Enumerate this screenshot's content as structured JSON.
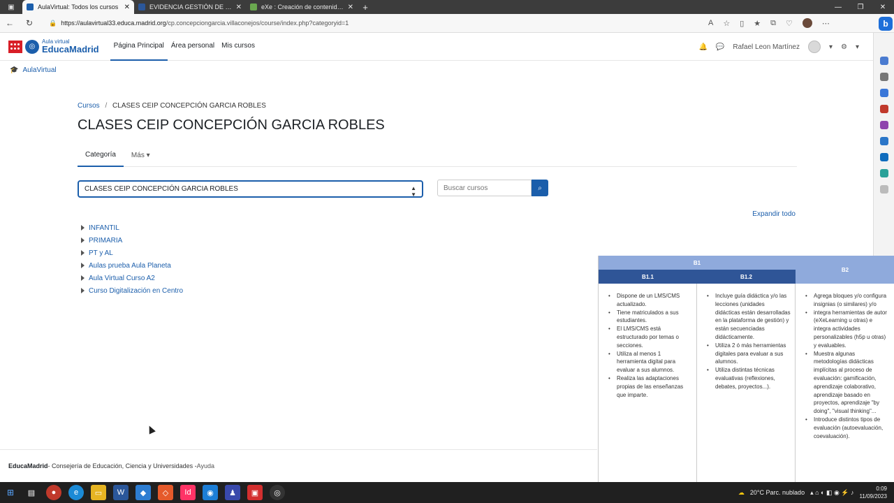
{
  "browser": {
    "tabs": [
      {
        "label": "AulaVirtual: Todos los cursos",
        "color": "#1b5eab",
        "active": true
      },
      {
        "label": "EVIDENCIA GESTIÓN DE PLATAF",
        "color": "#2b579a",
        "active": false
      },
      {
        "label": "eXe : Creación de contenidos di",
        "color": "#6aa84f",
        "active": false
      }
    ],
    "new_tab": "+",
    "url_host": "https://aulavirtual33.educa.madrid.org",
    "url_path": "/cp.concepciongarcia.villaconejos/course/index.php?categoryid=1"
  },
  "navbar": {
    "logo_small": "Aula virtual",
    "logo_big": "EducaMadrid",
    "items": [
      "Página Principal",
      "Área personal",
      "Mis cursos"
    ],
    "user_name": "Rafael Leon Martínez"
  },
  "home_link": "AulaVirtual",
  "breadcrumb": {
    "root": "Cursos",
    "separator": "/",
    "current": "CLASES CEIP CONCEPCIÓN GARCIA ROBLES"
  },
  "page_title": "CLASES CEIP CONCEPCIÓN GARCIA ROBLES",
  "secondary_nav": {
    "category": "Categoría",
    "more": "Más"
  },
  "category_select": {
    "value": "CLASES CEIP CONCEPCIÓN GARCIA ROBLES"
  },
  "search": {
    "placeholder": "Buscar cursos"
  },
  "expand_all": "Expandir todo",
  "categories": [
    "INFANTIL",
    "PRIMARIA",
    "PT y AL",
    "Aulas prueba Aula Planeta",
    "Aula Virtual Curso A2",
    "Curso Digitalización en Centro"
  ],
  "footer": {
    "brand": "EducaMadrid",
    "text": " - Consejería de Educación, Ciencia y Universidades - ",
    "help": "Ayuda"
  },
  "rubric": {
    "b1": "B1",
    "b2": "B2",
    "b11": "B1.1",
    "b12": "B1.2",
    "col1": [
      "Dispone de un LMS/CMS actualizado.",
      "Tiene matriculados a sus estudiantes.",
      "El LMS/CMS está estructurado por temas o secciones.",
      "Utiliza al menos 1 herramienta digital para evaluar a sus alumnos.",
      "Realiza las adaptaciones propias de las enseñanzas que imparte."
    ],
    "col2": [
      "Incluye guía didáctica y/o las lecciones (unidades didácticas están desarrolladas en la plataforma de gestión) y están secuenciadas didácticamente.",
      "Utiliza 2 ó más herramientas digitales para evaluar a sus alumnos.",
      "Utiliza distintas técnicas evaluativas (reflexiones, debates, proyectos...)."
    ],
    "col3": [
      "Agrega bloques y/o configura insignias (o similares) y/o",
      "integra herramientas de autor (eXeLearning u otras) e integra actividades personalizables (h5p u otras) y evaluables.",
      "Muestra algunas metodologías didácticas implícitas al proceso de evaluación: gamificación, aprendizaje colaborativo, aprendizaje basado en proyectos, aprendizaje \"by doing\", \"visual thinking\"...",
      "Introduce distintos tipos de evaluación (autoevaluación, coevaluación)."
    ]
  },
  "taskbar": {
    "weather": "20°C  Parc. nublado",
    "time": "0:09",
    "date": "11/09/2023"
  }
}
